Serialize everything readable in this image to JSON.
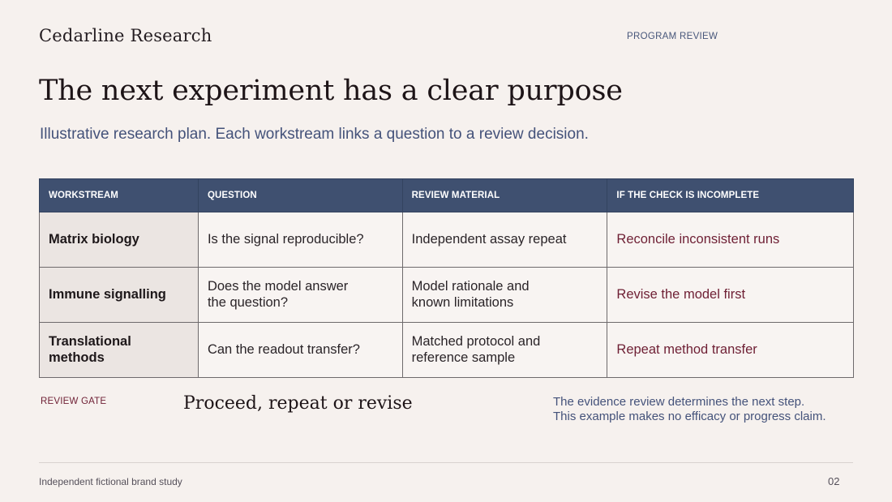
{
  "header": {
    "brand": "Cedarline Research",
    "section_label": "PROGRAM REVIEW"
  },
  "title": "The next experiment has a clear purpose",
  "subtitle": "Illustrative research plan. Each workstream links a question to a review decision.",
  "table": {
    "columns": [
      "WORKSTREAM",
      "QUESTION",
      "REVIEW MATERIAL",
      "IF THE CHECK IS INCOMPLETE"
    ],
    "rows": [
      {
        "workstream": "Matrix biology",
        "question": "Is the signal reproducible?",
        "material": "Independent assay repeat",
        "if_incomplete": "Reconcile inconsistent runs"
      },
      {
        "workstream": "Immune signalling",
        "question": "Does the model answer the question?",
        "material": "Model rationale and known limitations",
        "if_incomplete": "Revise the model first"
      },
      {
        "workstream": "Translational methods",
        "question": "Can the readout transfer?",
        "material": "Matched protocol and reference sample",
        "if_incomplete": "Repeat method transfer"
      }
    ]
  },
  "review_gate": {
    "label": "REVIEW GATE",
    "decision": "Proceed, repeat or revise",
    "note_line1": "The evidence review determines the next step.",
    "note_line2": "This example makes no efficacy or progress claim."
  },
  "footer": {
    "note": "Independent fictional brand study",
    "page_number": "02"
  },
  "colors": {
    "background": "#f6f1ee",
    "header_fill": "#3f5070",
    "accent_text": "#6e1f34",
    "muted_blue": "#44527a"
  }
}
